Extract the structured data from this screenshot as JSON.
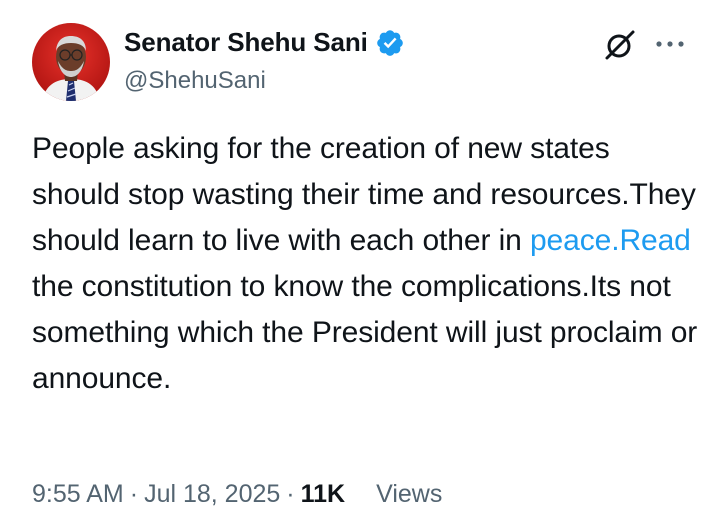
{
  "author": {
    "display_name": "Senator Shehu Sani",
    "handle": "@ShehuSani",
    "verified": true,
    "avatar_icon": "profile-photo"
  },
  "header_icons": {
    "grok": "grok-icon",
    "more": "more-icon"
  },
  "tweet": {
    "text_before_link": "People asking for the creation of new states should stop wasting their time and resources.They should learn to live with each other in ",
    "link_text": "peace.Read",
    "text_after_link": " the constitution to know the complications.Its not something which the President will just proclaim or announce."
  },
  "meta": {
    "time": "9:55 AM",
    "separator": "·",
    "date": "Jul 18, 2025",
    "views_count": "11K",
    "views_label": "Views"
  },
  "colors": {
    "link": "#1d9bf0",
    "verified_badge": "#1d9bf0",
    "secondary_text": "#536471",
    "primary_text": "#0f1419"
  }
}
